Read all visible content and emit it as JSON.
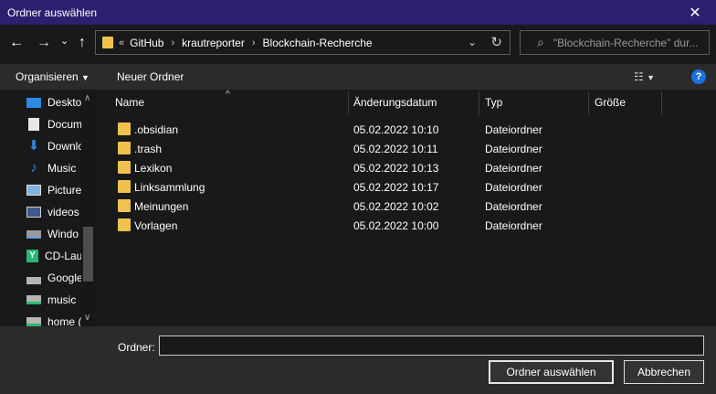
{
  "window": {
    "title": "Ordner auswählen"
  },
  "nav": {
    "back": "←",
    "forward": "→",
    "recent": "⌄",
    "up": "↑"
  },
  "address": {
    "prefix": "«",
    "crumbs": [
      "GitHub",
      "krautreporter",
      "Blockchain-Recherche"
    ],
    "separator": "›"
  },
  "search": {
    "placeholder": "\"Blockchain-Recherche\" dur..."
  },
  "toolbar": {
    "organize": "Organisieren",
    "new_folder": "Neuer Ordner",
    "help": "?"
  },
  "sidebar": {
    "items": [
      {
        "label": "Deskto",
        "icon": "desktop-icon"
      },
      {
        "label": "Docum",
        "icon": "documents-icon"
      },
      {
        "label": "Downlo",
        "icon": "downloads-icon"
      },
      {
        "label": "Music",
        "icon": "music-icon"
      },
      {
        "label": "Picture",
        "icon": "pictures-icon"
      },
      {
        "label": "videos",
        "icon": "videos-icon"
      },
      {
        "label": "Windo",
        "icon": "drive-icon"
      },
      {
        "label": "CD-Lau",
        "icon": "cd-drive-icon"
      },
      {
        "label": "Google",
        "icon": "network-drive-icon"
      },
      {
        "label": "music",
        "icon": "network-drive-icon"
      },
      {
        "label": "home (",
        "icon": "network-drive-icon"
      }
    ]
  },
  "columns": {
    "name": "Name",
    "date": "Änderungsdatum",
    "type": "Typ",
    "size": "Größe"
  },
  "files": [
    {
      "name": ".obsidian",
      "date": "05.02.2022 10:10",
      "type": "Dateiordner"
    },
    {
      "name": ".trash",
      "date": "05.02.2022 10:11",
      "type": "Dateiordner"
    },
    {
      "name": "Lexikon",
      "date": "05.02.2022 10:13",
      "type": "Dateiordner"
    },
    {
      "name": "Linksammlung",
      "date": "05.02.2022 10:17",
      "type": "Dateiordner"
    },
    {
      "name": "Meinungen",
      "date": "05.02.2022 10:02",
      "type": "Dateiordner"
    },
    {
      "name": "Vorlagen",
      "date": "05.02.2022 10:00",
      "type": "Dateiordner"
    }
  ],
  "footer": {
    "folder_label": "Ordner:",
    "folder_value": "",
    "select_button": "Ordner auswählen",
    "cancel_button": "Abbrechen"
  },
  "colors": {
    "titlebar": "#2b1f6e",
    "folder": "#f0c14d",
    "help": "#1a73d9"
  }
}
